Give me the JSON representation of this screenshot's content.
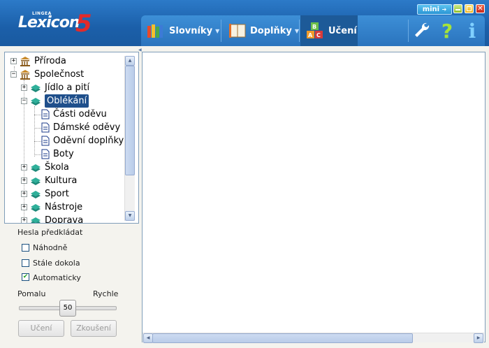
{
  "app": {
    "logo_small": "LINGEA",
    "logo_main": "Lexicon",
    "logo_number": "5"
  },
  "window_controls": {
    "mini_label": "mini"
  },
  "nav": {
    "items": [
      {
        "label": "Slovníky",
        "icon": "books-icon",
        "has_dropdown": true
      },
      {
        "label": "Doplňky",
        "icon": "book-icon",
        "has_dropdown": true
      },
      {
        "label": "Učení",
        "icon": "abc-blocks-icon",
        "active": true
      }
    ],
    "tools": [
      {
        "icon": "wrench-icon"
      },
      {
        "icon": "help-icon",
        "label": "?"
      },
      {
        "icon": "info-icon",
        "label": "i"
      }
    ]
  },
  "tree": {
    "items": [
      {
        "label": "Příroda",
        "level": 0,
        "expander": "+",
        "icon": "building-icon"
      },
      {
        "label": "Společnost",
        "level": 0,
        "expander": "−",
        "icon": "building-icon"
      },
      {
        "label": "Jídlo a pití",
        "level": 1,
        "expander": "+",
        "icon": "book-icon"
      },
      {
        "label": "Oblékání",
        "level": 1,
        "expander": "−",
        "icon": "book-icon",
        "selected": true
      },
      {
        "label": "Části oděvu",
        "level": 2,
        "icon": "document-icon"
      },
      {
        "label": "Dámské oděvy",
        "level": 2,
        "icon": "document-icon"
      },
      {
        "label": "Oděvní doplňky",
        "level": 2,
        "icon": "document-icon"
      },
      {
        "label": "Boty",
        "level": 2,
        "icon": "document-icon"
      },
      {
        "label": "Škola",
        "level": 1,
        "expander": "+",
        "icon": "book-icon"
      },
      {
        "label": "Kultura",
        "level": 1,
        "expander": "+",
        "icon": "book-icon"
      },
      {
        "label": "Sport",
        "level": 1,
        "expander": "+",
        "icon": "book-icon"
      },
      {
        "label": "Nástroje",
        "level": 1,
        "expander": "+",
        "icon": "book-icon"
      },
      {
        "label": "Doprava",
        "level": 1,
        "expander": "+",
        "icon": "book-icon"
      }
    ]
  },
  "options": {
    "heading": "Hesla předkládat",
    "checkboxes": [
      {
        "label": "Náhodně",
        "checked": false
      },
      {
        "label": "Stále dokola",
        "checked": false
      },
      {
        "label": "Automaticky",
        "checked": true
      }
    ],
    "speed": {
      "slow_label": "Pomalu",
      "fast_label": "Rychle",
      "value": "50"
    },
    "buttons": {
      "learn": "Učení",
      "test": "Zkoušení"
    }
  },
  "colors": {
    "header_blue": "#1b5fa9",
    "selection": "#1f4f8b",
    "logo_red": "#e22a2a"
  }
}
